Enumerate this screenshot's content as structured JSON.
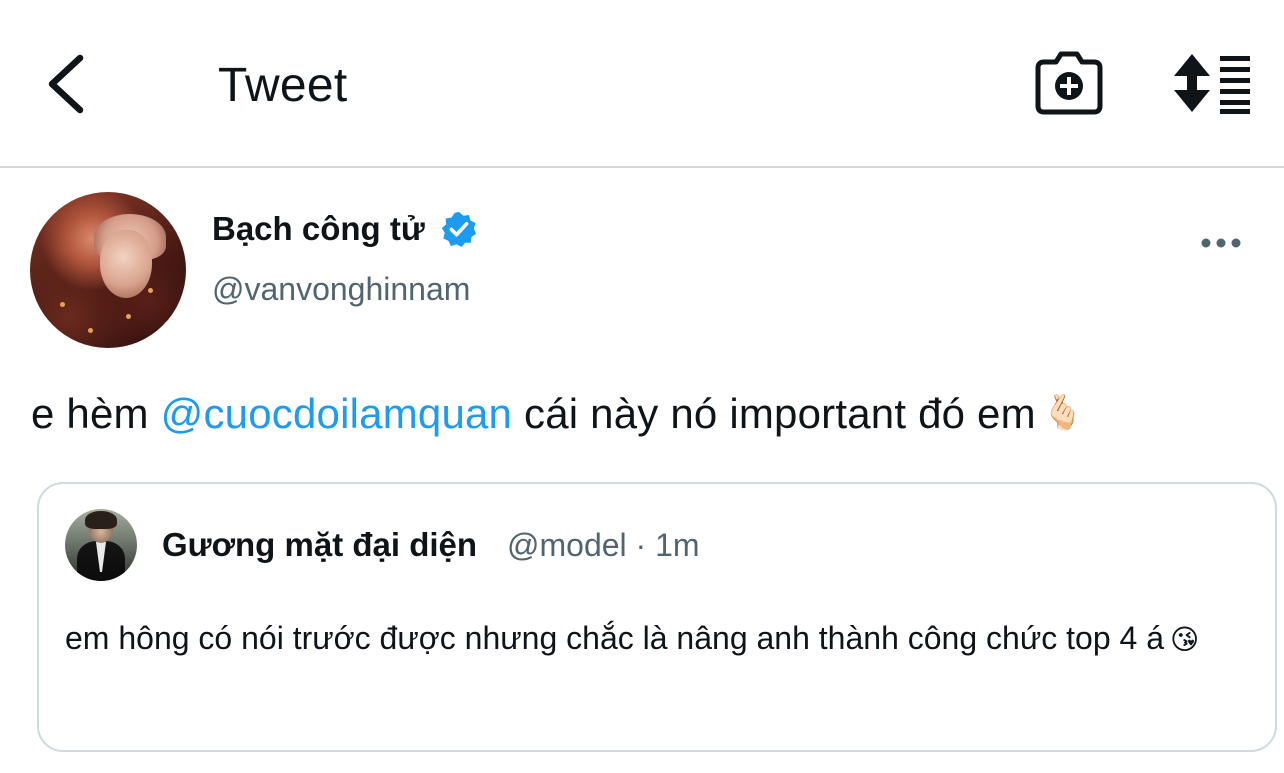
{
  "header": {
    "title": "Tweet",
    "icons": [
      "back-arrow-icon",
      "camera-add-icon",
      "sort-arrows-icon"
    ]
  },
  "tweet": {
    "author_name": "Bạch công tử",
    "author_handle": "@vanvonghinnam",
    "verified": true,
    "text_before": "e hèm ",
    "mention": "@cuocdoilamquan",
    "text_after": " cái này nó important đó em",
    "emoji": "🫰🏻",
    "more_icon": "ellipsis-icon"
  },
  "quoted_tweet": {
    "author_name": "Gương mặt đại diện",
    "author_handle": "@model",
    "separator": "·",
    "time": "1m",
    "text": "em hông có nói trước được nhưng chắc là nâng anh thành công chức top 4 á",
    "emoji": "😘"
  },
  "colors": {
    "accent": "#1d9bf0",
    "text": "#0f1419",
    "secondary_text": "#536471",
    "border": "#cfd9de"
  }
}
